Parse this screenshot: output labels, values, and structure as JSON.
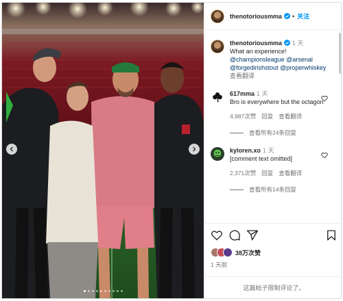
{
  "post": {
    "author": "thenotoriousmma",
    "follow_label": "关注",
    "separator": "•",
    "caption": {
      "text": "What an experience!",
      "time": "1 天",
      "mentions": [
        "@championsleague @arsenal",
        "@forgedirishstout @properwhiskey"
      ],
      "see_translation": "查看翻译"
    }
  },
  "comments": [
    {
      "user": "617mma",
      "time": "1 天",
      "text": "Bro is everywhere but the octagon",
      "likes": "4,987次赞",
      "reply_label": "回复",
      "translate_label": "查看翻译",
      "view_replies": "查看所有24条回复",
      "avatar_icon": "clover-icon"
    },
    {
      "user": "kyloren.xo",
      "time": "1 天",
      "text": "[comment text omitted]",
      "likes": "2,371次赞",
      "reply_label": "回复",
      "translate_label": "查看翻译",
      "view_replies": "查看所有14条回复",
      "avatar_icon": "green-character-icon"
    }
  ],
  "actions": {
    "icons": [
      "heart-icon",
      "comment-icon",
      "share-icon",
      "bookmark-icon"
    ],
    "likes_count": "38万次赞",
    "posted_ago": "1 天前",
    "comments_limited": "这篇帖子限制评论了。"
  },
  "carousel": {
    "slides": 10,
    "active_index": 0
  },
  "colors": {
    "link_blue": "#0095f6",
    "mention_blue": "#00376b",
    "muted": "#737373"
  }
}
